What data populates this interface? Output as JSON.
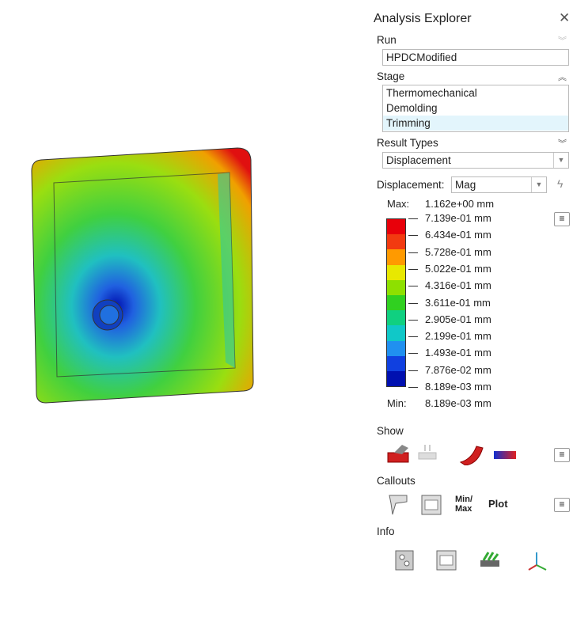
{
  "panel": {
    "title": "Analysis Explorer",
    "run": {
      "label": "Run",
      "value": "HPDCModified"
    },
    "stage": {
      "label": "Stage",
      "items": [
        "Thermomechanical",
        "Demolding",
        "Trimming"
      ],
      "selected": "Trimming"
    },
    "result_types": {
      "label": "Result Types",
      "value": "Displacement"
    },
    "displacement": {
      "label": "Displacement:",
      "component": "Mag"
    },
    "legend": {
      "max_label": "Max:",
      "max_value": "1.162e+00 mm",
      "min_label": "Min:",
      "min_value": "8.189e-03 mm",
      "ticks": [
        "7.139e-01 mm",
        "6.434e-01 mm",
        "5.728e-01 mm",
        "5.022e-01 mm",
        "4.316e-01 mm",
        "3.611e-01 mm",
        "2.905e-01 mm",
        "2.199e-01 mm",
        "1.493e-01 mm",
        "7.876e-02 mm",
        "8.189e-03 mm"
      ],
      "colors": [
        "#e8000a",
        "#f23a10",
        "#ff9a00",
        "#e8e800",
        "#8ee000",
        "#30d020",
        "#10d080",
        "#10c8c8",
        "#2090f0",
        "#1040e0",
        "#0010b0"
      ]
    },
    "show": {
      "label": "Show"
    },
    "callouts": {
      "label": "Callouts",
      "minmax": "Min/ Max",
      "plot": "Plot"
    },
    "info": {
      "label": "Info"
    }
  }
}
